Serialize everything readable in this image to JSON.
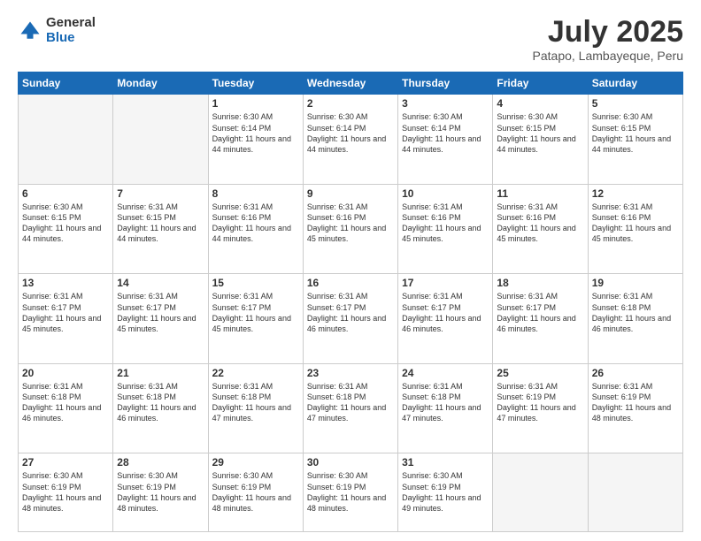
{
  "logo": {
    "general": "General",
    "blue": "Blue"
  },
  "title": "July 2025",
  "subtitle": "Patapo, Lambayeque, Peru",
  "days_of_week": [
    "Sunday",
    "Monday",
    "Tuesday",
    "Wednesday",
    "Thursday",
    "Friday",
    "Saturday"
  ],
  "weeks": [
    [
      {
        "day": "",
        "info": ""
      },
      {
        "day": "",
        "info": ""
      },
      {
        "day": "1",
        "info": "Sunrise: 6:30 AM\nSunset: 6:14 PM\nDaylight: 11 hours and 44 minutes."
      },
      {
        "day": "2",
        "info": "Sunrise: 6:30 AM\nSunset: 6:14 PM\nDaylight: 11 hours and 44 minutes."
      },
      {
        "day": "3",
        "info": "Sunrise: 6:30 AM\nSunset: 6:14 PM\nDaylight: 11 hours and 44 minutes."
      },
      {
        "day": "4",
        "info": "Sunrise: 6:30 AM\nSunset: 6:15 PM\nDaylight: 11 hours and 44 minutes."
      },
      {
        "day": "5",
        "info": "Sunrise: 6:30 AM\nSunset: 6:15 PM\nDaylight: 11 hours and 44 minutes."
      }
    ],
    [
      {
        "day": "6",
        "info": "Sunrise: 6:30 AM\nSunset: 6:15 PM\nDaylight: 11 hours and 44 minutes."
      },
      {
        "day": "7",
        "info": "Sunrise: 6:31 AM\nSunset: 6:15 PM\nDaylight: 11 hours and 44 minutes."
      },
      {
        "day": "8",
        "info": "Sunrise: 6:31 AM\nSunset: 6:16 PM\nDaylight: 11 hours and 44 minutes."
      },
      {
        "day": "9",
        "info": "Sunrise: 6:31 AM\nSunset: 6:16 PM\nDaylight: 11 hours and 45 minutes."
      },
      {
        "day": "10",
        "info": "Sunrise: 6:31 AM\nSunset: 6:16 PM\nDaylight: 11 hours and 45 minutes."
      },
      {
        "day": "11",
        "info": "Sunrise: 6:31 AM\nSunset: 6:16 PM\nDaylight: 11 hours and 45 minutes."
      },
      {
        "day": "12",
        "info": "Sunrise: 6:31 AM\nSunset: 6:16 PM\nDaylight: 11 hours and 45 minutes."
      }
    ],
    [
      {
        "day": "13",
        "info": "Sunrise: 6:31 AM\nSunset: 6:17 PM\nDaylight: 11 hours and 45 minutes."
      },
      {
        "day": "14",
        "info": "Sunrise: 6:31 AM\nSunset: 6:17 PM\nDaylight: 11 hours and 45 minutes."
      },
      {
        "day": "15",
        "info": "Sunrise: 6:31 AM\nSunset: 6:17 PM\nDaylight: 11 hours and 45 minutes."
      },
      {
        "day": "16",
        "info": "Sunrise: 6:31 AM\nSunset: 6:17 PM\nDaylight: 11 hours and 46 minutes."
      },
      {
        "day": "17",
        "info": "Sunrise: 6:31 AM\nSunset: 6:17 PM\nDaylight: 11 hours and 46 minutes."
      },
      {
        "day": "18",
        "info": "Sunrise: 6:31 AM\nSunset: 6:17 PM\nDaylight: 11 hours and 46 minutes."
      },
      {
        "day": "19",
        "info": "Sunrise: 6:31 AM\nSunset: 6:18 PM\nDaylight: 11 hours and 46 minutes."
      }
    ],
    [
      {
        "day": "20",
        "info": "Sunrise: 6:31 AM\nSunset: 6:18 PM\nDaylight: 11 hours and 46 minutes."
      },
      {
        "day": "21",
        "info": "Sunrise: 6:31 AM\nSunset: 6:18 PM\nDaylight: 11 hours and 46 minutes."
      },
      {
        "day": "22",
        "info": "Sunrise: 6:31 AM\nSunset: 6:18 PM\nDaylight: 11 hours and 47 minutes."
      },
      {
        "day": "23",
        "info": "Sunrise: 6:31 AM\nSunset: 6:18 PM\nDaylight: 11 hours and 47 minutes."
      },
      {
        "day": "24",
        "info": "Sunrise: 6:31 AM\nSunset: 6:18 PM\nDaylight: 11 hours and 47 minutes."
      },
      {
        "day": "25",
        "info": "Sunrise: 6:31 AM\nSunset: 6:19 PM\nDaylight: 11 hours and 47 minutes."
      },
      {
        "day": "26",
        "info": "Sunrise: 6:31 AM\nSunset: 6:19 PM\nDaylight: 11 hours and 48 minutes."
      }
    ],
    [
      {
        "day": "27",
        "info": "Sunrise: 6:30 AM\nSunset: 6:19 PM\nDaylight: 11 hours and 48 minutes."
      },
      {
        "day": "28",
        "info": "Sunrise: 6:30 AM\nSunset: 6:19 PM\nDaylight: 11 hours and 48 minutes."
      },
      {
        "day": "29",
        "info": "Sunrise: 6:30 AM\nSunset: 6:19 PM\nDaylight: 11 hours and 48 minutes."
      },
      {
        "day": "30",
        "info": "Sunrise: 6:30 AM\nSunset: 6:19 PM\nDaylight: 11 hours and 48 minutes."
      },
      {
        "day": "31",
        "info": "Sunrise: 6:30 AM\nSunset: 6:19 PM\nDaylight: 11 hours and 49 minutes."
      },
      {
        "day": "",
        "info": ""
      },
      {
        "day": "",
        "info": ""
      }
    ]
  ]
}
